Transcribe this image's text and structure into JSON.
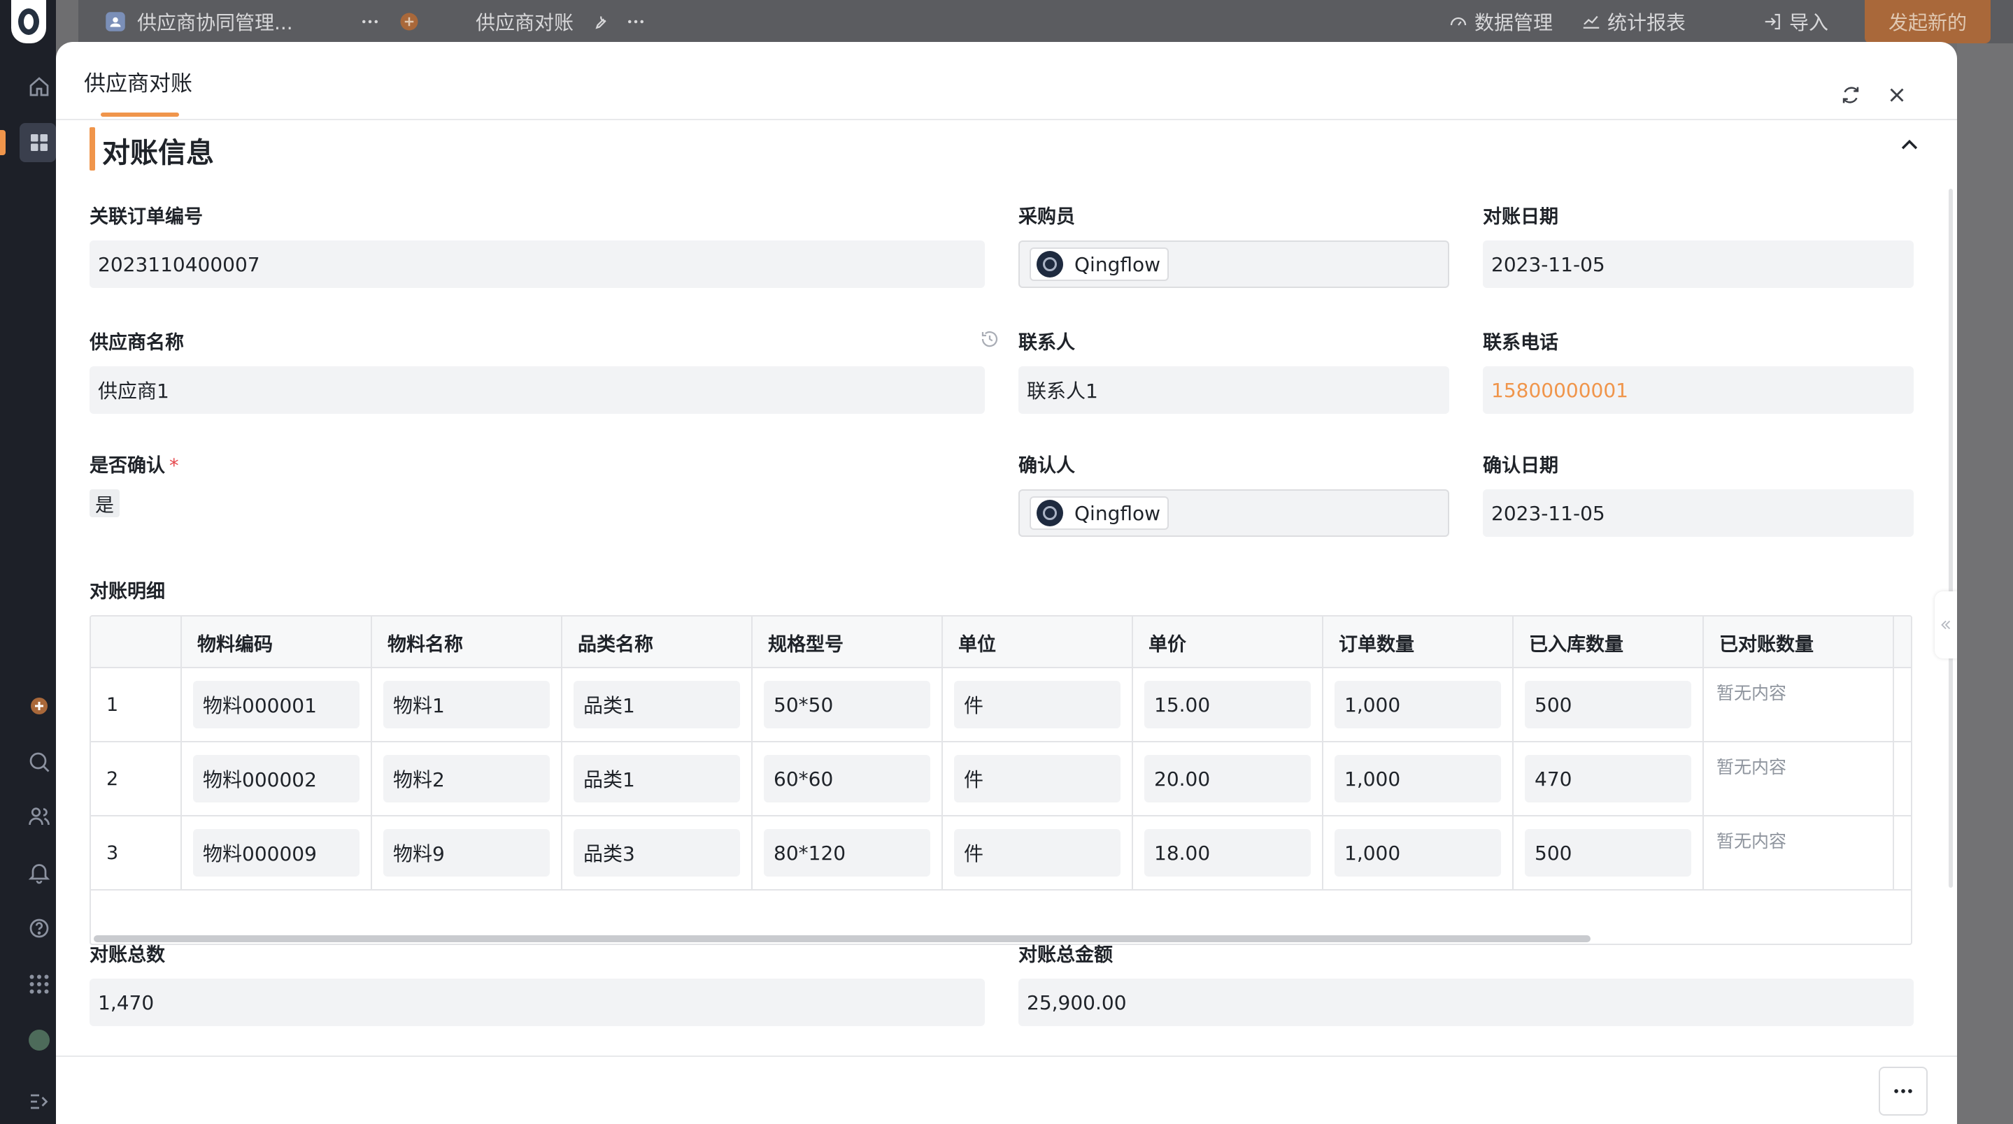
{
  "topbar": {
    "app_name": "供应商协同管理...",
    "view_name": "供应商对账",
    "data_mgmt": "数据管理",
    "stats": "统计报表",
    "import": "导入",
    "start_new": "发起新的"
  },
  "modal": {
    "title": "供应商对账",
    "section_title": "对账信息"
  },
  "fields": {
    "order_no": {
      "label": "关联订单编号",
      "value": "2023110400007"
    },
    "buyer": {
      "label": "采购员",
      "value": "Qingflow"
    },
    "recon_date": {
      "label": "对账日期",
      "value": "2023-11-05"
    },
    "supplier": {
      "label": "供应商名称",
      "value": "供应商1"
    },
    "contact": {
      "label": "联系人",
      "value": "联系人1"
    },
    "phone": {
      "label": "联系电话",
      "value": "15800000001"
    },
    "confirmed": {
      "label": "是否确认",
      "required_mark": "*",
      "value": "是"
    },
    "confirmer": {
      "label": "确认人",
      "value": "Qingflow"
    },
    "confirm_date": {
      "label": "确认日期",
      "value": "2023-11-05"
    },
    "total_qty": {
      "label": "对账总数",
      "value": "1,470"
    },
    "total_amount": {
      "label": "对账总金额",
      "value": "25,900.00"
    }
  },
  "detail": {
    "label": "对账明细",
    "columns": [
      "物料编码",
      "物料名称",
      "品类名称",
      "规格型号",
      "单位",
      "单价",
      "订单数量",
      "已入库数量",
      "已对账数量"
    ],
    "empty_text": "暂无内容",
    "rows": [
      {
        "idx": "1",
        "code": "物料000001",
        "name": "物料1",
        "category": "品类1",
        "spec": "50*50",
        "unit": "件",
        "price": "15.00",
        "order_qty": "1,000",
        "in_qty": "500"
      },
      {
        "idx": "2",
        "code": "物料000002",
        "name": "物料2",
        "category": "品类1",
        "spec": "60*60",
        "unit": "件",
        "price": "20.00",
        "order_qty": "1,000",
        "in_qty": "470"
      },
      {
        "idx": "3",
        "code": "物料000009",
        "name": "物料9",
        "category": "品类3",
        "spec": "80*120",
        "unit": "件",
        "price": "18.00",
        "order_qty": "1,000",
        "in_qty": "500"
      }
    ]
  },
  "icons": {
    "refresh": "refresh-icon",
    "close": "close-icon",
    "collapse": "chevron-up-icon",
    "more": "more-icon",
    "history": "history-icon"
  },
  "colors": {
    "accent": "#f0954b",
    "phone_link": "#f0954b",
    "required": "#e5484d"
  }
}
